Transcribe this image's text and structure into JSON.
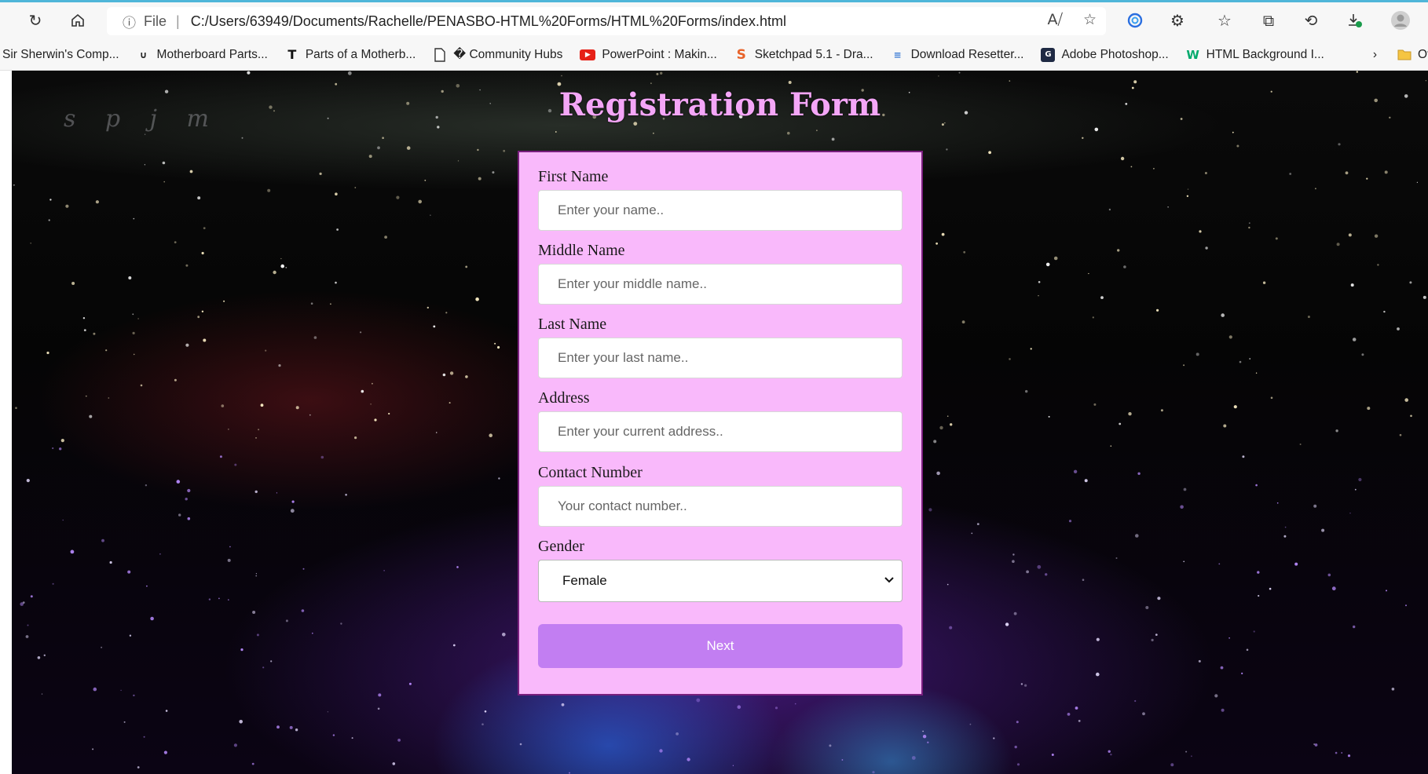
{
  "browser": {
    "address": {
      "scheme_label": "File",
      "separator": "|",
      "url": "C:/Users/63949/Documents/Rachelle/PENASBO-HTML%20Forms/HTML%20Forms/index.html"
    },
    "icons": {
      "refresh": "refresh-icon",
      "home": "home-icon",
      "info": "info-icon",
      "read_aloud": "read-aloud-icon",
      "favorite_add": "favorite-add-icon",
      "copilot": "copilot-icon",
      "extensions": "extensions-icon",
      "favorites": "favorites-icon",
      "collections": "collections-icon",
      "history": "history-icon",
      "downloads": "downloads-icon",
      "profile": "profile-icon"
    },
    "bookmarks": [
      {
        "label": "Sir Sherwin's Comp...",
        "icon": ""
      },
      {
        "label": "Motherboard Parts...",
        "icon": "horseshoe-icon"
      },
      {
        "label": "Parts of a Motherb...",
        "icon": "t-logo-icon"
      },
      {
        "label": "� Community Hubs",
        "icon": "page-icon"
      },
      {
        "label": "PowerPoint : Makin...",
        "icon": "youtube-icon"
      },
      {
        "label": "Sketchpad 5.1 - Dra...",
        "icon": "sketchpad-icon"
      },
      {
        "label": "Download Resetter...",
        "icon": "resetter-icon"
      },
      {
        "label": "Adobe Photoshop...",
        "icon": "gc-icon"
      },
      {
        "label": "HTML Background I...",
        "icon": "w3-icon"
      }
    ],
    "bookmarks_more": "Other fa"
  },
  "page": {
    "title": "Registration Form",
    "watermark": "s p j m",
    "form": {
      "first_name": {
        "label": "First Name",
        "placeholder": "Enter your name.."
      },
      "middle_name": {
        "label": "Middle Name",
        "placeholder": "Enter your middle name.."
      },
      "last_name": {
        "label": "Last Name",
        "placeholder": "Enter your last name.."
      },
      "address": {
        "label": "Address",
        "placeholder": "Enter your current address.."
      },
      "contact": {
        "label": "Contact Number",
        "placeholder": "Your contact number.."
      },
      "gender": {
        "label": "Gender",
        "selected": "Female"
      },
      "next_label": "Next"
    }
  },
  "colors": {
    "title": "#f4a6f7",
    "card_bg": "#f9b9fb",
    "card_border": "#7a1f7e",
    "button_bg": "#c27ef2"
  }
}
